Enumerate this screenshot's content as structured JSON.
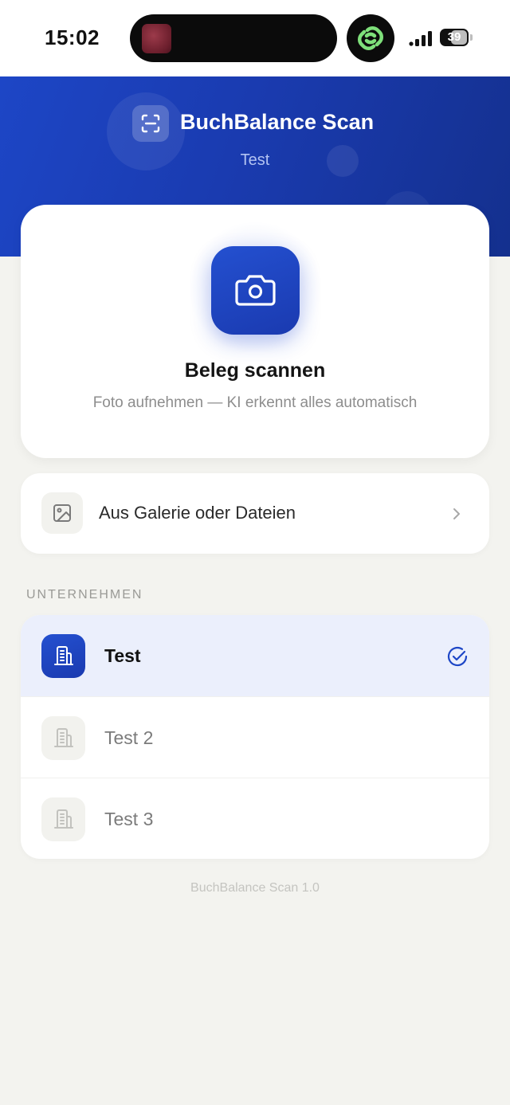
{
  "status_bar": {
    "time": "15:02",
    "battery": "39",
    "island_app_icon": "link-rings-icon"
  },
  "header": {
    "title": "BuchBalance Scan",
    "subtitle": "Test",
    "logo_icon": "scan-frame-icon"
  },
  "scan_card": {
    "title": "Beleg scannen",
    "subtitle": "Foto aufnehmen — KI erkennt alles automatisch",
    "icon": "camera-icon"
  },
  "gallery": {
    "label": "Aus Galerie oder Dateien",
    "icon": "image-icon"
  },
  "companies": {
    "section_label": "UNTERNEHMEN",
    "items": [
      {
        "name": "Test",
        "selected": true
      },
      {
        "name": "Test 2",
        "selected": false
      },
      {
        "name": "Test 3",
        "selected": false
      }
    ]
  },
  "footer": {
    "version": "BuchBalance Scan 1.0"
  },
  "colors": {
    "accent": "#1d46c6",
    "background": "#f3f3ef",
    "selected_row": "#ebeffc"
  }
}
